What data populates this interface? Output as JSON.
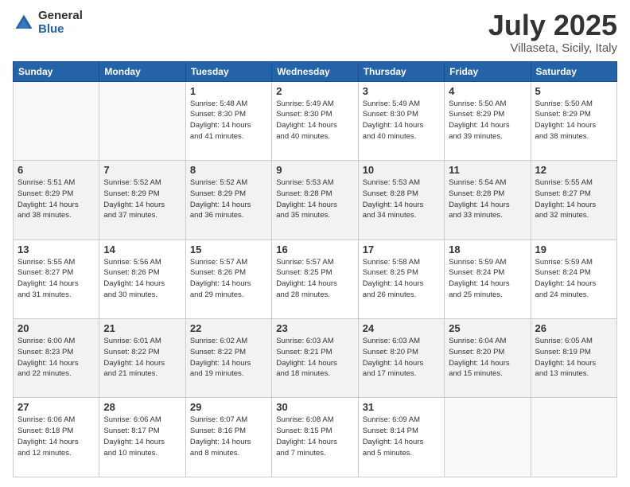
{
  "logo": {
    "general": "General",
    "blue": "Blue"
  },
  "title": "July 2025",
  "subtitle": "Villaseta, Sicily, Italy",
  "weekdays": [
    "Sunday",
    "Monday",
    "Tuesday",
    "Wednesday",
    "Thursday",
    "Friday",
    "Saturday"
  ],
  "weeks": [
    [
      {
        "day": "",
        "info": ""
      },
      {
        "day": "",
        "info": ""
      },
      {
        "day": "1",
        "info": "Sunrise: 5:48 AM\nSunset: 8:30 PM\nDaylight: 14 hours\nand 41 minutes."
      },
      {
        "day": "2",
        "info": "Sunrise: 5:49 AM\nSunset: 8:30 PM\nDaylight: 14 hours\nand 40 minutes."
      },
      {
        "day": "3",
        "info": "Sunrise: 5:49 AM\nSunset: 8:30 PM\nDaylight: 14 hours\nand 40 minutes."
      },
      {
        "day": "4",
        "info": "Sunrise: 5:50 AM\nSunset: 8:29 PM\nDaylight: 14 hours\nand 39 minutes."
      },
      {
        "day": "5",
        "info": "Sunrise: 5:50 AM\nSunset: 8:29 PM\nDaylight: 14 hours\nand 38 minutes."
      }
    ],
    [
      {
        "day": "6",
        "info": "Sunrise: 5:51 AM\nSunset: 8:29 PM\nDaylight: 14 hours\nand 38 minutes."
      },
      {
        "day": "7",
        "info": "Sunrise: 5:52 AM\nSunset: 8:29 PM\nDaylight: 14 hours\nand 37 minutes."
      },
      {
        "day": "8",
        "info": "Sunrise: 5:52 AM\nSunset: 8:29 PM\nDaylight: 14 hours\nand 36 minutes."
      },
      {
        "day": "9",
        "info": "Sunrise: 5:53 AM\nSunset: 8:28 PM\nDaylight: 14 hours\nand 35 minutes."
      },
      {
        "day": "10",
        "info": "Sunrise: 5:53 AM\nSunset: 8:28 PM\nDaylight: 14 hours\nand 34 minutes."
      },
      {
        "day": "11",
        "info": "Sunrise: 5:54 AM\nSunset: 8:28 PM\nDaylight: 14 hours\nand 33 minutes."
      },
      {
        "day": "12",
        "info": "Sunrise: 5:55 AM\nSunset: 8:27 PM\nDaylight: 14 hours\nand 32 minutes."
      }
    ],
    [
      {
        "day": "13",
        "info": "Sunrise: 5:55 AM\nSunset: 8:27 PM\nDaylight: 14 hours\nand 31 minutes."
      },
      {
        "day": "14",
        "info": "Sunrise: 5:56 AM\nSunset: 8:26 PM\nDaylight: 14 hours\nand 30 minutes."
      },
      {
        "day": "15",
        "info": "Sunrise: 5:57 AM\nSunset: 8:26 PM\nDaylight: 14 hours\nand 29 minutes."
      },
      {
        "day": "16",
        "info": "Sunrise: 5:57 AM\nSunset: 8:25 PM\nDaylight: 14 hours\nand 28 minutes."
      },
      {
        "day": "17",
        "info": "Sunrise: 5:58 AM\nSunset: 8:25 PM\nDaylight: 14 hours\nand 26 minutes."
      },
      {
        "day": "18",
        "info": "Sunrise: 5:59 AM\nSunset: 8:24 PM\nDaylight: 14 hours\nand 25 minutes."
      },
      {
        "day": "19",
        "info": "Sunrise: 5:59 AM\nSunset: 8:24 PM\nDaylight: 14 hours\nand 24 minutes."
      }
    ],
    [
      {
        "day": "20",
        "info": "Sunrise: 6:00 AM\nSunset: 8:23 PM\nDaylight: 14 hours\nand 22 minutes."
      },
      {
        "day": "21",
        "info": "Sunrise: 6:01 AM\nSunset: 8:22 PM\nDaylight: 14 hours\nand 21 minutes."
      },
      {
        "day": "22",
        "info": "Sunrise: 6:02 AM\nSunset: 8:22 PM\nDaylight: 14 hours\nand 19 minutes."
      },
      {
        "day": "23",
        "info": "Sunrise: 6:03 AM\nSunset: 8:21 PM\nDaylight: 14 hours\nand 18 minutes."
      },
      {
        "day": "24",
        "info": "Sunrise: 6:03 AM\nSunset: 8:20 PM\nDaylight: 14 hours\nand 17 minutes."
      },
      {
        "day": "25",
        "info": "Sunrise: 6:04 AM\nSunset: 8:20 PM\nDaylight: 14 hours\nand 15 minutes."
      },
      {
        "day": "26",
        "info": "Sunrise: 6:05 AM\nSunset: 8:19 PM\nDaylight: 14 hours\nand 13 minutes."
      }
    ],
    [
      {
        "day": "27",
        "info": "Sunrise: 6:06 AM\nSunset: 8:18 PM\nDaylight: 14 hours\nand 12 minutes."
      },
      {
        "day": "28",
        "info": "Sunrise: 6:06 AM\nSunset: 8:17 PM\nDaylight: 14 hours\nand 10 minutes."
      },
      {
        "day": "29",
        "info": "Sunrise: 6:07 AM\nSunset: 8:16 PM\nDaylight: 14 hours\nand 8 minutes."
      },
      {
        "day": "30",
        "info": "Sunrise: 6:08 AM\nSunset: 8:15 PM\nDaylight: 14 hours\nand 7 minutes."
      },
      {
        "day": "31",
        "info": "Sunrise: 6:09 AM\nSunset: 8:14 PM\nDaylight: 14 hours\nand 5 minutes."
      },
      {
        "day": "",
        "info": ""
      },
      {
        "day": "",
        "info": ""
      }
    ]
  ]
}
